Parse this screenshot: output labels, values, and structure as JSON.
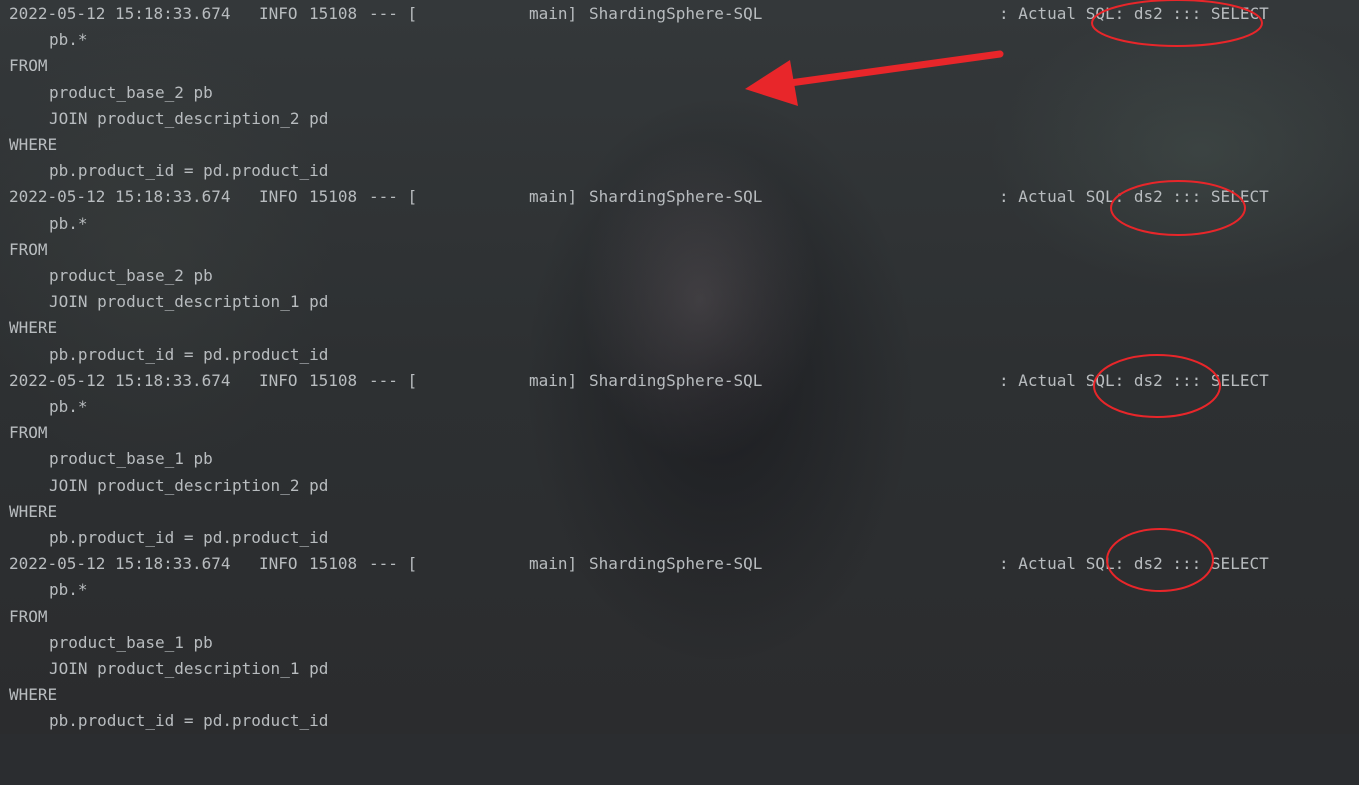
{
  "log_entries": [
    {
      "header": {
        "timestamp": "2022-05-12 15:18:33.674",
        "level": "INFO",
        "pid": "15108",
        "separator": "--- [",
        "thread": "main]",
        "logger": "ShardingSphere-SQL",
        "message": ": Actual SQL: ds2 ::: SELECT"
      },
      "select": "pb.*",
      "from_kw": "FROM",
      "table": "product_base_2 pb",
      "join": "JOIN product_description_2 pd",
      "where_kw": "WHERE",
      "condition": "pb.product_id = pd.product_id"
    },
    {
      "header": {
        "timestamp": "2022-05-12 15:18:33.674",
        "level": "INFO",
        "pid": "15108",
        "separator": "--- [",
        "thread": "main]",
        "logger": "ShardingSphere-SQL",
        "message": ": Actual SQL: ds2 ::: SELECT"
      },
      "select": "pb.*",
      "from_kw": "FROM",
      "table": "product_base_2 pb",
      "join": "JOIN product_description_1 pd",
      "where_kw": "WHERE",
      "condition": "pb.product_id = pd.product_id"
    },
    {
      "header": {
        "timestamp": "2022-05-12 15:18:33.674",
        "level": "INFO",
        "pid": "15108",
        "separator": "--- [",
        "thread": "main]",
        "logger": "ShardingSphere-SQL",
        "message": ": Actual SQL: ds2 ::: SELECT"
      },
      "select": "pb.*",
      "from_kw": "FROM",
      "table": "product_base_1 pb",
      "join": "JOIN product_description_2 pd",
      "where_kw": "WHERE",
      "condition": "pb.product_id = pd.product_id"
    },
    {
      "header": {
        "timestamp": "2022-05-12 15:18:33.674",
        "level": "INFO",
        "pid": "15108",
        "separator": "--- [",
        "thread": "main]",
        "logger": "ShardingSphere-SQL",
        "message": ": Actual SQL: ds2 ::: SELECT"
      },
      "select": "pb.*",
      "from_kw": "FROM",
      "table": "product_base_1 pb",
      "join": "JOIN product_description_1 pd",
      "where_kw": "WHERE",
      "condition": "pb.product_id = pd.product_id"
    }
  ],
  "colors": {
    "console_text": "#b8bcbf",
    "annotation_red": "#e8262a"
  },
  "annotations": {
    "circle_icon": "red-ellipse-highlight",
    "arrow_icon": "red-arrow"
  }
}
